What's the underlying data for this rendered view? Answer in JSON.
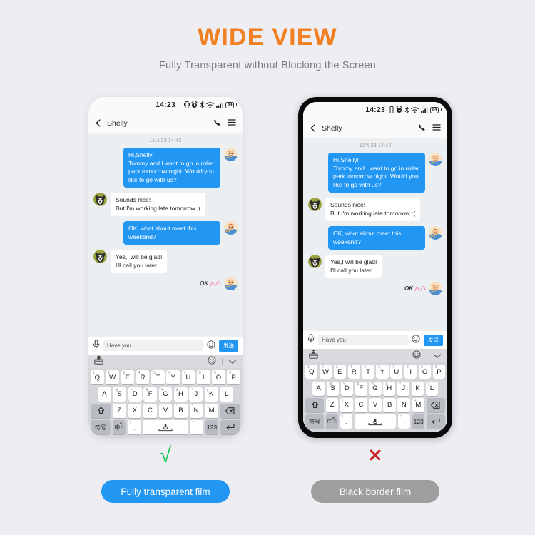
{
  "header": {
    "title": "WIDE VIEW",
    "subtitle": "Fully Transparent without Blocking the Screen",
    "title_color": "#f08021",
    "subtitle_color": "#7b7b83"
  },
  "background_color": "#eeedf2",
  "phone_screen": {
    "status_bar": {
      "time": "14:23",
      "battery_level": "84",
      "icons": [
        "vibrate-icon",
        "alarm-icon",
        "bluetooth-icon",
        "wifi-icon",
        "signal-icon",
        "battery-icon"
      ]
    },
    "chat_header": {
      "back_icon": "chevron-left-icon",
      "contact_name": "Shelly",
      "call_icon": "phone-icon",
      "menu_icon": "hamburger-menu-icon"
    },
    "conversation": {
      "timestamp": "11/4/23 14:42",
      "messages": [
        {
          "direction": "out",
          "text": "Hi,Shelly!\nTommy and I want to go in roller park tomorrow night. Would you like to go with us?",
          "avatar": "me-avatar"
        },
        {
          "direction": "in",
          "text": "Sounds nice!\nBut I'm working late tomorrow :(",
          "avatar": "shelly-avatar"
        },
        {
          "direction": "out",
          "text": "OK, what about meet this weekend?",
          "avatar": "me-avatar"
        },
        {
          "direction": "in",
          "text": "Yes,I will be glad!\nI'll call you later",
          "avatar": "shelly-avatar"
        }
      ],
      "sticker": {
        "label": "OK",
        "avatar": "me-avatar"
      },
      "bubble_out_color": "#2196f3",
      "bubble_in_color": "#ffffff",
      "background_color": "#eceff1"
    },
    "input_bar": {
      "mic_icon": "microphone-icon",
      "text_value": "Have you",
      "emoji_icon": "smiley-icon",
      "send_label": "发送",
      "send_color": "#2196f3"
    },
    "keyboard": {
      "toolbar": {
        "sticker_icon": "sticker-pack-icon",
        "emoji_icon": "smiley-icon",
        "collapse_icon": "chevron-down-icon"
      },
      "row1": [
        {
          "key": "Q",
          "sup": "1"
        },
        {
          "key": "W",
          "sup": "2"
        },
        {
          "key": "E",
          "sup": "3"
        },
        {
          "key": "R",
          "sup": "4"
        },
        {
          "key": "T",
          "sup": "5"
        },
        {
          "key": "Y",
          "sup": "6"
        },
        {
          "key": "U",
          "sup": "7"
        },
        {
          "key": "I",
          "sup": "8"
        },
        {
          "key": "O",
          "sup": "9"
        },
        {
          "key": "P",
          "sup": "0"
        }
      ],
      "row2": [
        {
          "key": "A",
          "sup": "~"
        },
        {
          "key": "S",
          "sup": "@"
        },
        {
          "key": "D",
          "sup": "#"
        },
        {
          "key": "F",
          "sup": "$"
        },
        {
          "key": "G",
          "sup": "%"
        },
        {
          "key": "H",
          "sup": "&"
        },
        {
          "key": "J",
          "sup": "*"
        },
        {
          "key": "K",
          "sup": "("
        },
        {
          "key": "L",
          "sup": ")"
        }
      ],
      "row3": [
        {
          "key": "Z",
          "sup": "-"
        },
        {
          "key": "X",
          "sup": "/"
        },
        {
          "key": "C",
          "sup": ":"
        },
        {
          "key": "V",
          "sup": ";"
        },
        {
          "key": "B",
          "sup": "'"
        },
        {
          "key": "N",
          "sup": "\""
        },
        {
          "key": "M",
          "sup": "+"
        }
      ],
      "shift_icon": "shift-up-icon",
      "backspace_icon": "backspace-icon",
      "row4": {
        "symbols_label": "符号",
        "lang_label": "中",
        "lang_sub": "英",
        "comma_sup": "!",
        "comma_label": ",",
        "space_icon": "microphone-icon",
        "period_sup": "?",
        "period_label": ".",
        "num_label": "123",
        "enter_icon": "enter-return-icon"
      }
    }
  },
  "comparison": {
    "good": {
      "mark": "√",
      "mark_color": "#22c55e",
      "pill_label": "Fully transparent film",
      "pill_color": "#2196f3"
    },
    "bad": {
      "mark": "✕",
      "mark_color": "#c62828",
      "pill_label": "Black border film",
      "pill_color": "#9e9e9e"
    }
  }
}
